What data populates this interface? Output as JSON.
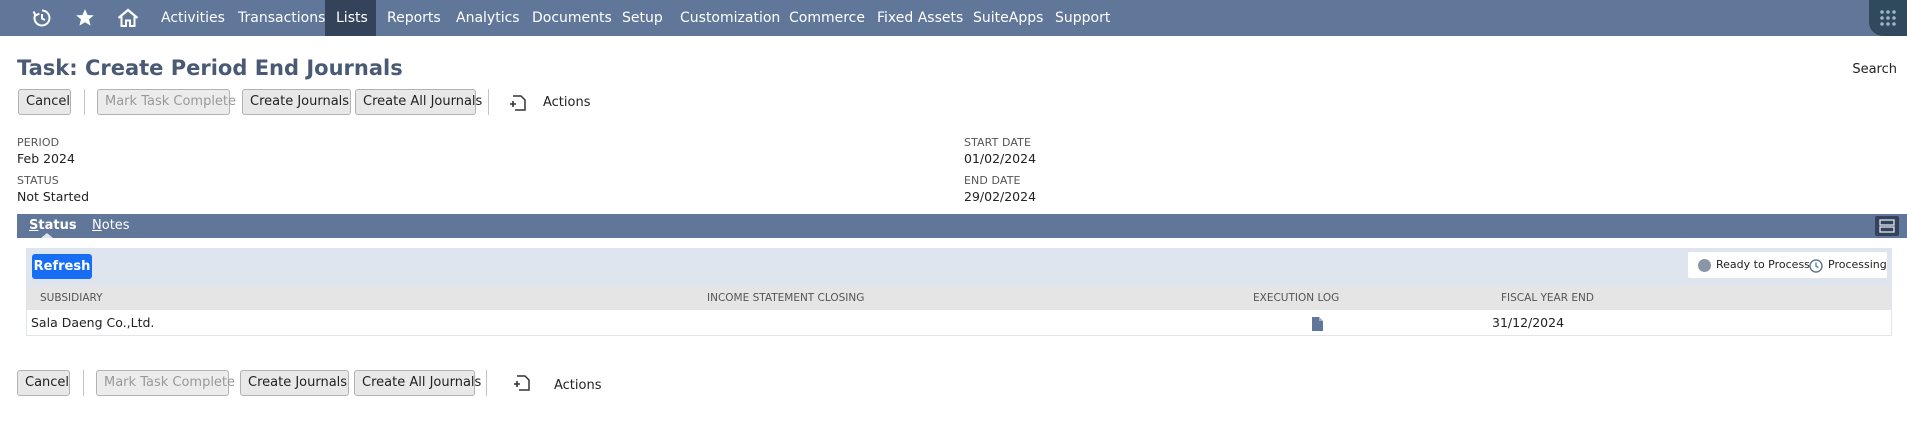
{
  "nav": {
    "items": [
      {
        "label": "Activities"
      },
      {
        "label": "Transactions"
      },
      {
        "label": "Lists",
        "active": true
      },
      {
        "label": "Reports"
      },
      {
        "label": "Analytics"
      },
      {
        "label": "Documents"
      },
      {
        "label": "Setup"
      },
      {
        "label": "Customization"
      },
      {
        "label": "Commerce"
      },
      {
        "label": "Fixed Assets"
      },
      {
        "label": "SuiteApps"
      },
      {
        "label": "Support"
      }
    ],
    "icons": [
      "recent-records-icon",
      "star-icon",
      "home-icon",
      "apps-grid-icon"
    ]
  },
  "page": {
    "title": "Task: Create Period End Journals",
    "search_label": "Search"
  },
  "buttons": {
    "cancel": "Cancel",
    "mark_complete": "Mark Task Complete",
    "create_journals": "Create Journals",
    "create_all": "Create All Journals",
    "actions": "Actions"
  },
  "fields": {
    "period_label": "PERIOD",
    "period_value": "Feb 2024",
    "status_label": "STATUS",
    "status_value": "Not Started",
    "start_label": "START DATE",
    "start_value": "01/02/2024",
    "end_label": "END DATE",
    "end_value": "29/02/2024"
  },
  "subtabs": {
    "status_first": "S",
    "status_rest": "tatus",
    "notes_first": "N",
    "notes_rest": "otes"
  },
  "sublist": {
    "refresh_label": "Refresh",
    "legend": {
      "ready": "Ready to Process",
      "processing": "Processing"
    },
    "columns": [
      "SUBSIDIARY",
      "INCOME STATEMENT CLOSING",
      "EXECUTION LOG",
      "FISCAL YEAR END"
    ],
    "rows": [
      {
        "subsidiary": "Sala Daeng Co.,Ltd.",
        "income_statement_closing": "",
        "execution_log_icon": "document-icon",
        "fiscal_year_end": "31/12/2024"
      }
    ]
  },
  "colors": {
    "nav_bg": "#607799",
    "nav_active": "#34435a",
    "title": "#4a5a74",
    "refresh_bg": "#176ef5",
    "panel_bg": "#dfe5ee",
    "legend_ready": "#8a96a8",
    "legend_processing": "#607799"
  }
}
